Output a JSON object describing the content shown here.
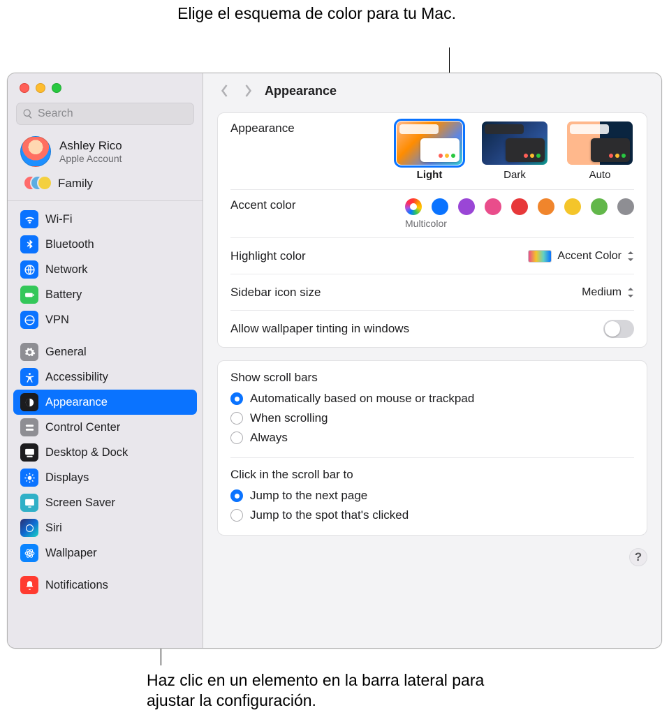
{
  "annotations": {
    "top": "Elige el esquema de color para tu Mac.",
    "bottom": "Haz clic en un elemento en la barra lateral para ajustar la configuración."
  },
  "search": {
    "placeholder": "Search"
  },
  "account": {
    "name": "Ashley Rico",
    "sub": "Apple Account",
    "family": "Family"
  },
  "sidebar": {
    "items": [
      {
        "label": "Wi-Fi"
      },
      {
        "label": "Bluetooth"
      },
      {
        "label": "Network"
      },
      {
        "label": "Battery"
      },
      {
        "label": "VPN"
      },
      {
        "label": "General"
      },
      {
        "label": "Accessibility"
      },
      {
        "label": "Appearance",
        "selected": true
      },
      {
        "label": "Control Center"
      },
      {
        "label": "Desktop & Dock"
      },
      {
        "label": "Displays"
      },
      {
        "label": "Screen Saver"
      },
      {
        "label": "Siri"
      },
      {
        "label": "Wallpaper"
      },
      {
        "label": "Notifications"
      }
    ]
  },
  "page": {
    "title": "Appearance"
  },
  "appearance": {
    "label": "Appearance",
    "options": [
      {
        "label": "Light",
        "selected": true
      },
      {
        "label": "Dark"
      },
      {
        "label": "Auto"
      }
    ]
  },
  "accent": {
    "label": "Accent color",
    "selected_label": "Multicolor",
    "colors": [
      "multicolor",
      "blue",
      "purple",
      "pink",
      "red",
      "orange",
      "yellow",
      "green",
      "graphite"
    ]
  },
  "highlight": {
    "label": "Highlight color",
    "value": "Accent Color"
  },
  "sidebar_size": {
    "label": "Sidebar icon size",
    "value": "Medium"
  },
  "tinting": {
    "label": "Allow wallpaper tinting in windows",
    "value": false
  },
  "scrollbars": {
    "title": "Show scroll bars",
    "options": [
      {
        "label": "Automatically based on mouse or trackpad",
        "selected": true
      },
      {
        "label": "When scrolling"
      },
      {
        "label": "Always"
      }
    ]
  },
  "click_scroll": {
    "title": "Click in the scroll bar to",
    "options": [
      {
        "label": "Jump to the next page",
        "selected": true
      },
      {
        "label": "Jump to the spot that's clicked"
      }
    ]
  },
  "help": "?"
}
